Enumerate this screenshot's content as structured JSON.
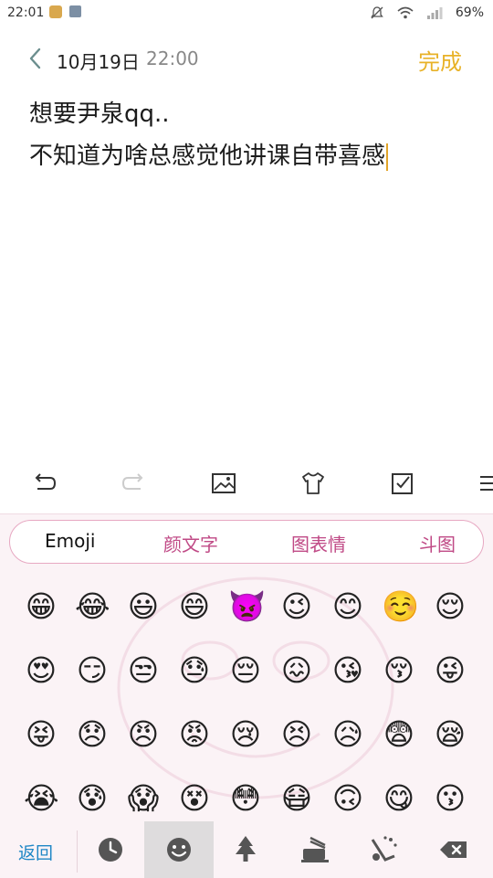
{
  "status_bar": {
    "time": "22:01",
    "battery": "69%"
  },
  "header": {
    "date": "10月19日",
    "time": "22:00",
    "done_label": "完成"
  },
  "note": {
    "line1": "想要尹泉qq..",
    "line2": "不知道为啥总感觉他讲课自带喜感"
  },
  "editor_toolbar": {
    "items": [
      "undo-icon",
      "redo-icon",
      "image-icon",
      "theme-icon",
      "checklist-icon",
      "list-icon"
    ]
  },
  "keyboard": {
    "tabs": [
      "Emoji",
      "颜文字",
      "图表情",
      "斗图"
    ],
    "active_tab": "Emoji",
    "emoji_rows": [
      [
        "😁",
        "😂",
        "😃",
        "😄",
        "👿",
        "😉",
        "😊",
        "☺️",
        "😌"
      ],
      [
        "😍",
        "😏",
        "😒",
        "😓",
        "😔",
        "😖",
        "😘",
        "😚",
        "😜"
      ],
      [
        "😝",
        "😞",
        "😠",
        "😡",
        "😢",
        "😣",
        "😥",
        "😨",
        "😪"
      ],
      [
        "😭",
        "😰",
        "😱",
        "😵",
        "😳",
        "😷",
        "🙃",
        "😋",
        "😗"
      ]
    ],
    "bottom_bar": {
      "back_label": "返回",
      "icons": [
        "recent-icon",
        "smiley-icon",
        "tree-icon",
        "food-icon",
        "activity-icon",
        "backspace-icon"
      ],
      "selected": "smiley-icon"
    }
  }
}
